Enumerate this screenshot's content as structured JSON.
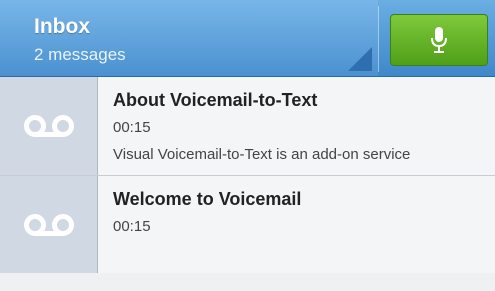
{
  "header": {
    "title": "Inbox",
    "subtitle": "2 messages",
    "mic_icon": "microphone-icon",
    "accent": "#4b91d0",
    "mic_button_color": "#66b52a"
  },
  "messages": [
    {
      "title": "About Voicemail-to-Text",
      "duration": "00:15",
      "preview": "Visual Voicemail-to-Text is an add-on service",
      "icon": "voicemail-icon"
    },
    {
      "title": "Welcome to Voicemail",
      "duration": "00:15",
      "icon": "voicemail-icon"
    }
  ]
}
